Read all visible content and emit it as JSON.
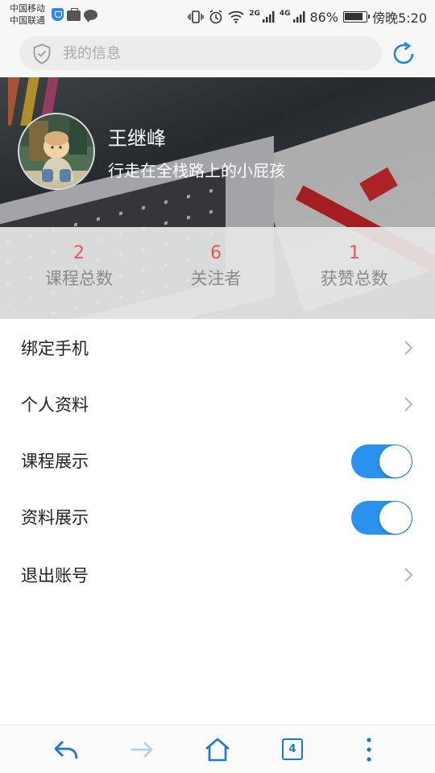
{
  "status_bar": {
    "carrier_1": "中国移动",
    "carrier_2": "中国联通",
    "network_2g": "2G",
    "network_4g": "4G",
    "battery": "86%",
    "time": "傍晚5:20"
  },
  "search": {
    "placeholder": "我的信息"
  },
  "profile": {
    "name": "王继峰",
    "motto": "行走在全栈路上的小屁孩",
    "stats": [
      {
        "value": "2",
        "label": "课程总数"
      },
      {
        "value": "6",
        "label": "关注者"
      },
      {
        "value": "1",
        "label": "获赞总数"
      }
    ]
  },
  "settings": [
    {
      "label": "绑定手机",
      "control": "chevron"
    },
    {
      "label": "个人资料",
      "control": "chevron"
    },
    {
      "label": "课程展示",
      "control": "toggle",
      "on": true
    },
    {
      "label": "资料展示",
      "control": "toggle",
      "on": true
    },
    {
      "label": "退出账号",
      "control": "chevron"
    }
  ],
  "bottom_nav": {
    "tab_count": "4",
    "items": [
      "back-icon",
      "forward-icon",
      "home-icon",
      "tabs-icon",
      "more-icon"
    ]
  },
  "colors": {
    "accent": "#2a92ee",
    "stat_number": "#e05a54",
    "nav_icon": "#1c77d6"
  }
}
